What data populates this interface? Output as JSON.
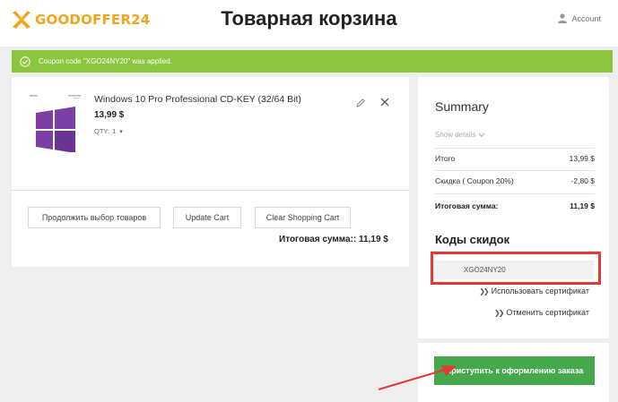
{
  "header": {
    "brand": "GOODOFFER24",
    "title": "Товарная корзина",
    "account_label": "Account"
  },
  "notice": {
    "text": "Coupon code \"XGO24NY20\" was applied."
  },
  "cart": {
    "item": {
      "name": "Windows 10 Pro Professional CD-KEY (32/64 Bit)",
      "price": "13,99 $",
      "qty_label": "QTY:",
      "qty_value": "1"
    },
    "buttons": {
      "continue": "Продолжить выбор товаров",
      "update": "Update Cart",
      "clear": "Clear Shopping Cart"
    },
    "total": "Итоговая сумма:: 11,19 $"
  },
  "summary": {
    "title": "Summary",
    "show_details": "Show details",
    "rows": [
      {
        "label": "Итого",
        "value": "13,99 $"
      },
      {
        "label": "Скидка ( Coupon 20%)",
        "value": "-2,80 $"
      },
      {
        "label": "Итоговая сумма:",
        "value": "11,19 $"
      }
    ],
    "codes_title": "Коды скидок",
    "coupon_value": "XGO24NY20",
    "apply_label": "Использовать сертификат",
    "cancel_label": "Отменить сертификат",
    "checkout_label": "Приступить к оформлению заказа"
  },
  "colors": {
    "brand": "#f2a51d",
    "notice_bg": "#8cc63f",
    "checkout_bg": "#46a84d",
    "highlight": "#e53935",
    "windows_tile": "#7b3fa6"
  }
}
